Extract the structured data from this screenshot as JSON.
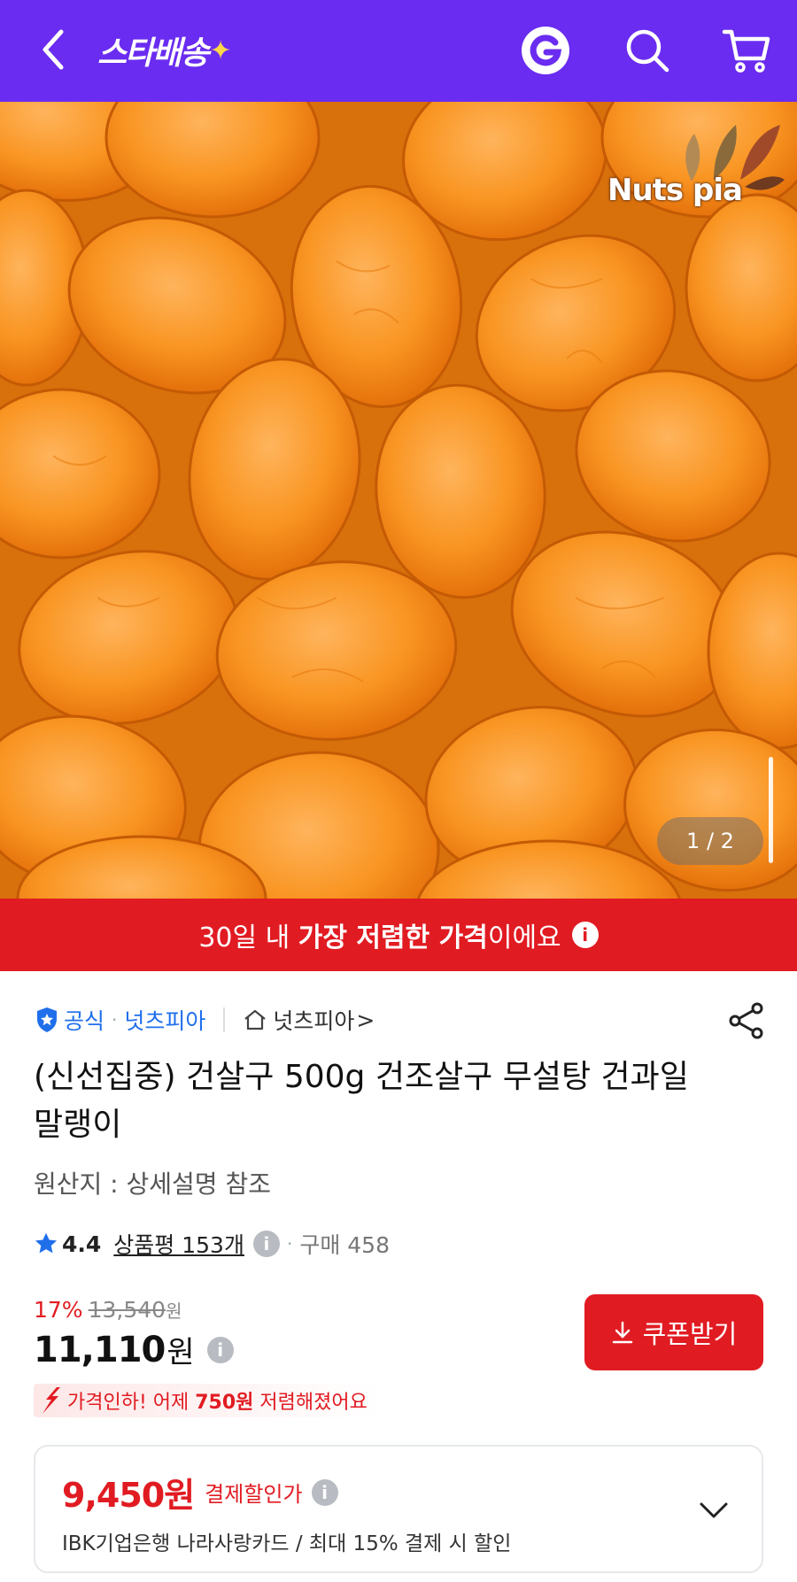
{
  "header": {
    "logo_text": "스타배송",
    "logo_spark": "✦",
    "colors": {
      "bg": "#6a2cf0",
      "spark": "#ffd54a"
    },
    "icons": [
      "back-arrow-icon",
      "g-logo-icon",
      "search-icon",
      "cart-icon"
    ]
  },
  "hero": {
    "brand_logo_text": "Nuts pia",
    "image_counter": "1 / 2"
  },
  "banner": {
    "prefix": "30일 내 ",
    "highlight": "가장 저렴한 가격",
    "suffix": "이에요",
    "info": "i",
    "color": "#e11b22"
  },
  "seller": {
    "official_label": "공식",
    "separator": "·",
    "seller_name": "넛츠피아",
    "store_name": "넛츠피아",
    "store_chevron": ">"
  },
  "product": {
    "title": "(신선집중) 건살구 500g 건조살구 무설탕 건과일 말랭이",
    "origin": "원산지 : 상세설명 참조"
  },
  "rating": {
    "score": "4.4",
    "reviews": "상품평 153개",
    "info": "i",
    "separator": "·",
    "purchases": "구매 458"
  },
  "pricing": {
    "discount_rate": "17%",
    "original_price": "13,540",
    "original_unit": "원",
    "price": "11,110",
    "price_unit": "원",
    "info": "i",
    "coupon_button": "쿠폰받기",
    "drop_prefix": "가격인하! 어제 ",
    "drop_amount": "750원",
    "drop_suffix": " 저렴해졌어요"
  },
  "payment_discount": {
    "price": "9,450원",
    "label": "결제할인가",
    "info": "i",
    "description": "IBK기업은행 나라사랑카드 / 최대 15% 결제 시 할인"
  }
}
